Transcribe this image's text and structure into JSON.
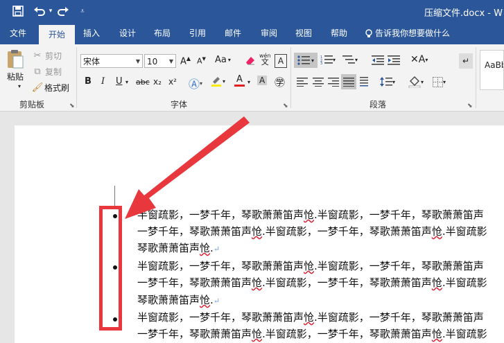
{
  "titlebar": {
    "save_icon": "save-icon",
    "undo_icon": "undo-icon",
    "redo_icon": "redo-icon",
    "customize_icon": "customize-quick-access-icon",
    "title": "压缩文件.docx  -  W"
  },
  "tabs": [
    {
      "label": "文件"
    },
    {
      "label": "开始"
    },
    {
      "label": "插入"
    },
    {
      "label": "设计"
    },
    {
      "label": "布局"
    },
    {
      "label": "引用"
    },
    {
      "label": "邮件"
    },
    {
      "label": "审阅"
    },
    {
      "label": "视图"
    },
    {
      "label": "帮助"
    },
    {
      "label": "告诉我你想要做什么"
    }
  ],
  "clipboard": {
    "paste": "粘贴",
    "cut": "剪切",
    "copy": "复制",
    "format_painter": "格式刷",
    "group_label": "剪贴板"
  },
  "font": {
    "font_name": "宋体",
    "font_size": "10",
    "case_label": "Aa",
    "phonetic": "wén",
    "char_border": "A",
    "bold": "B",
    "italic": "I",
    "underline": "U",
    "strike": "abc",
    "subscript": "x₂",
    "superscript": "x²",
    "group_label": "字体"
  },
  "paragraph": {
    "group_label": "段落"
  },
  "styles": {
    "preview": "AaBbC"
  },
  "document": {
    "lines": [
      {
        "text": "半窗疏影，一梦千年，琴歌萧萧笛声",
        "err": "怆",
        "rest": ".半窗疏影，一梦千年，琴歌萧萧笛声"
      },
      {
        "text": "一梦千年，琴歌萧萧笛声",
        "err": "怆",
        "rest": ".半窗疏影，一梦千年，琴歌萧萧笛声",
        "err2": "怆",
        "rest2": ".半窗疏影"
      },
      {
        "text": "琴歌萧萧笛声",
        "err": "怆",
        "rest": "."
      },
      {
        "text": "半窗疏影，一梦千年，琴歌萧萧笛声",
        "err": "怆",
        "rest": ".半窗疏影，一梦千年，琴歌萧萧笛声"
      },
      {
        "text": "一梦千年，琴歌萧萧笛声",
        "err": "怆",
        "rest": ".半窗疏影，一梦千年，琴歌萧萧笛声",
        "err2": "怆",
        "rest2": ".半窗疏影"
      },
      {
        "text": "琴歌萧萧笛声",
        "err": "怆",
        "rest": "."
      },
      {
        "text": "半窗疏影，一梦千年，琴歌萧萧笛声",
        "err": "怆",
        "rest": ".半窗疏影，一梦千年，琴歌萧萧笛声"
      },
      {
        "text": "一梦千年，琴歌萧萧笛声",
        "err": "怆",
        "rest": ".半窗疏影，一梦千年，琴歌萧萧笛声",
        "err2": "怆",
        "rest2": ".半窗疏影"
      }
    ],
    "paragraph_mark": "↵"
  },
  "annotation": {
    "highlight_color": "#e8383d",
    "arrow_icon": "pointer-arrow"
  },
  "colors": {
    "brand": "#2b579a",
    "ribbon": "#f3f3f3"
  }
}
